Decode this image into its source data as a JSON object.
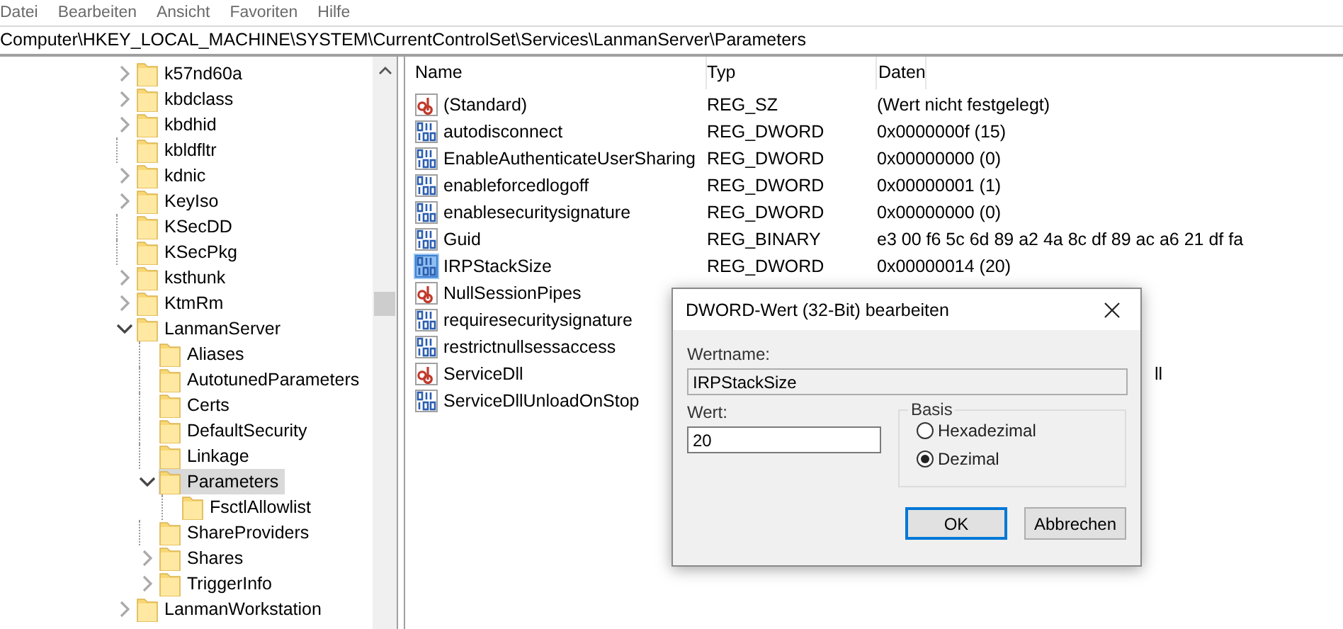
{
  "menu": [
    "Datei",
    "Bearbeiten",
    "Ansicht",
    "Favoriten",
    "Hilfe"
  ],
  "address": "Computer\\HKEY_LOCAL_MACHINE\\SYSTEM\\CurrentControlSet\\Services\\LanmanServer\\Parameters",
  "tree": [
    {
      "kind": "branch",
      "label": "k57nd60a",
      "expanded": false,
      "selected": false
    },
    {
      "kind": "branch",
      "label": "kbdclass",
      "expanded": false,
      "selected": false
    },
    {
      "kind": "branch",
      "label": "kbdhid",
      "expanded": false,
      "selected": false
    },
    {
      "kind": "leaf",
      "label": "kbldfltr",
      "selected": false
    },
    {
      "kind": "branch",
      "label": "kdnic",
      "expanded": false,
      "selected": false
    },
    {
      "kind": "branch",
      "label": "KeyIso",
      "expanded": false,
      "selected": false
    },
    {
      "kind": "leaf",
      "label": "KSecDD",
      "selected": false
    },
    {
      "kind": "leaf",
      "label": "KSecPkg",
      "selected": false
    },
    {
      "kind": "branch",
      "label": "ksthunk",
      "expanded": false,
      "selected": false
    },
    {
      "kind": "branch",
      "label": "KtmRm",
      "expanded": false,
      "selected": false
    },
    {
      "kind": "branch",
      "label": "LanmanServer",
      "expanded": true,
      "selected": false,
      "children": [
        {
          "kind": "leaf",
          "label": "Aliases",
          "selected": false
        },
        {
          "kind": "leaf",
          "label": "AutotunedParameters",
          "selected": false
        },
        {
          "kind": "leaf",
          "label": "Certs",
          "selected": false
        },
        {
          "kind": "leaf",
          "label": "DefaultSecurity",
          "selected": false
        },
        {
          "kind": "leaf",
          "label": "Linkage",
          "selected": false
        },
        {
          "kind": "branch",
          "label": "Parameters",
          "expanded": true,
          "selected": true,
          "children": [
            {
              "kind": "leaf",
              "label": "FsctlAllowlist",
              "selected": false
            }
          ]
        },
        {
          "kind": "leaf",
          "label": "ShareProviders",
          "selected": false
        },
        {
          "kind": "branch",
          "label": "Shares",
          "expanded": false,
          "selected": false
        },
        {
          "kind": "branch",
          "label": "TriggerInfo",
          "expanded": false,
          "selected": false
        }
      ]
    },
    {
      "kind": "branch",
      "label": "LanmanWorkstation",
      "expanded": false,
      "selected": false
    }
  ],
  "table": {
    "columns": [
      "Name",
      "Typ",
      "Daten"
    ],
    "rows": [
      {
        "kind": "string",
        "name": "(Standard)",
        "type": "REG_SZ",
        "data": "(Wert nicht festgelegt)",
        "selected": false
      },
      {
        "kind": "binary",
        "name": "autodisconnect",
        "type": "REG_DWORD",
        "data": "0x0000000f (15)",
        "selected": false
      },
      {
        "kind": "binary",
        "name": "EnableAuthenticateUserSharing",
        "type": "REG_DWORD",
        "data": "0x00000000 (0)",
        "selected": false
      },
      {
        "kind": "binary",
        "name": "enableforcedlogoff",
        "type": "REG_DWORD",
        "data": "0x00000001 (1)",
        "selected": false
      },
      {
        "kind": "binary",
        "name": "enablesecuritysignature",
        "type": "REG_DWORD",
        "data": "0x00000000 (0)",
        "selected": false
      },
      {
        "kind": "binary",
        "name": "Guid",
        "type": "REG_BINARY",
        "data": "e3 00 f6 5c 6d 89 a2 4a 8c df 89 ac a6 21 df fa",
        "selected": false
      },
      {
        "kind": "binary",
        "name": "IRPStackSize",
        "type": "REG_DWORD",
        "data": "0x00000014 (20)",
        "selected": true
      },
      {
        "kind": "string",
        "name": "NullSessionPipes",
        "selected": false
      },
      {
        "kind": "binary",
        "name": "requiresecuritysignature",
        "selected": false
      },
      {
        "kind": "binary",
        "name": "restrictnullsessaccess",
        "selected": false
      },
      {
        "kind": "string",
        "name": "ServiceDll",
        "data_tail": "ll",
        "selected": false
      },
      {
        "kind": "binary",
        "name": "ServiceDllUnloadOnStop",
        "selected": false
      }
    ]
  },
  "dialog": {
    "title": "DWORD-Wert (32-Bit) bearbeiten",
    "name_label": "Wertname:",
    "name_value": "IRPStackSize",
    "value_label": "Wert:",
    "value": "20",
    "base_label": "Basis",
    "bases": [
      {
        "label": "Hexadezimal",
        "selected": false
      },
      {
        "label": "Dezimal",
        "selected": true
      }
    ],
    "buttons": [
      {
        "label": "OK",
        "default": true
      },
      {
        "label": "Abbrechen",
        "default": false
      }
    ]
  }
}
